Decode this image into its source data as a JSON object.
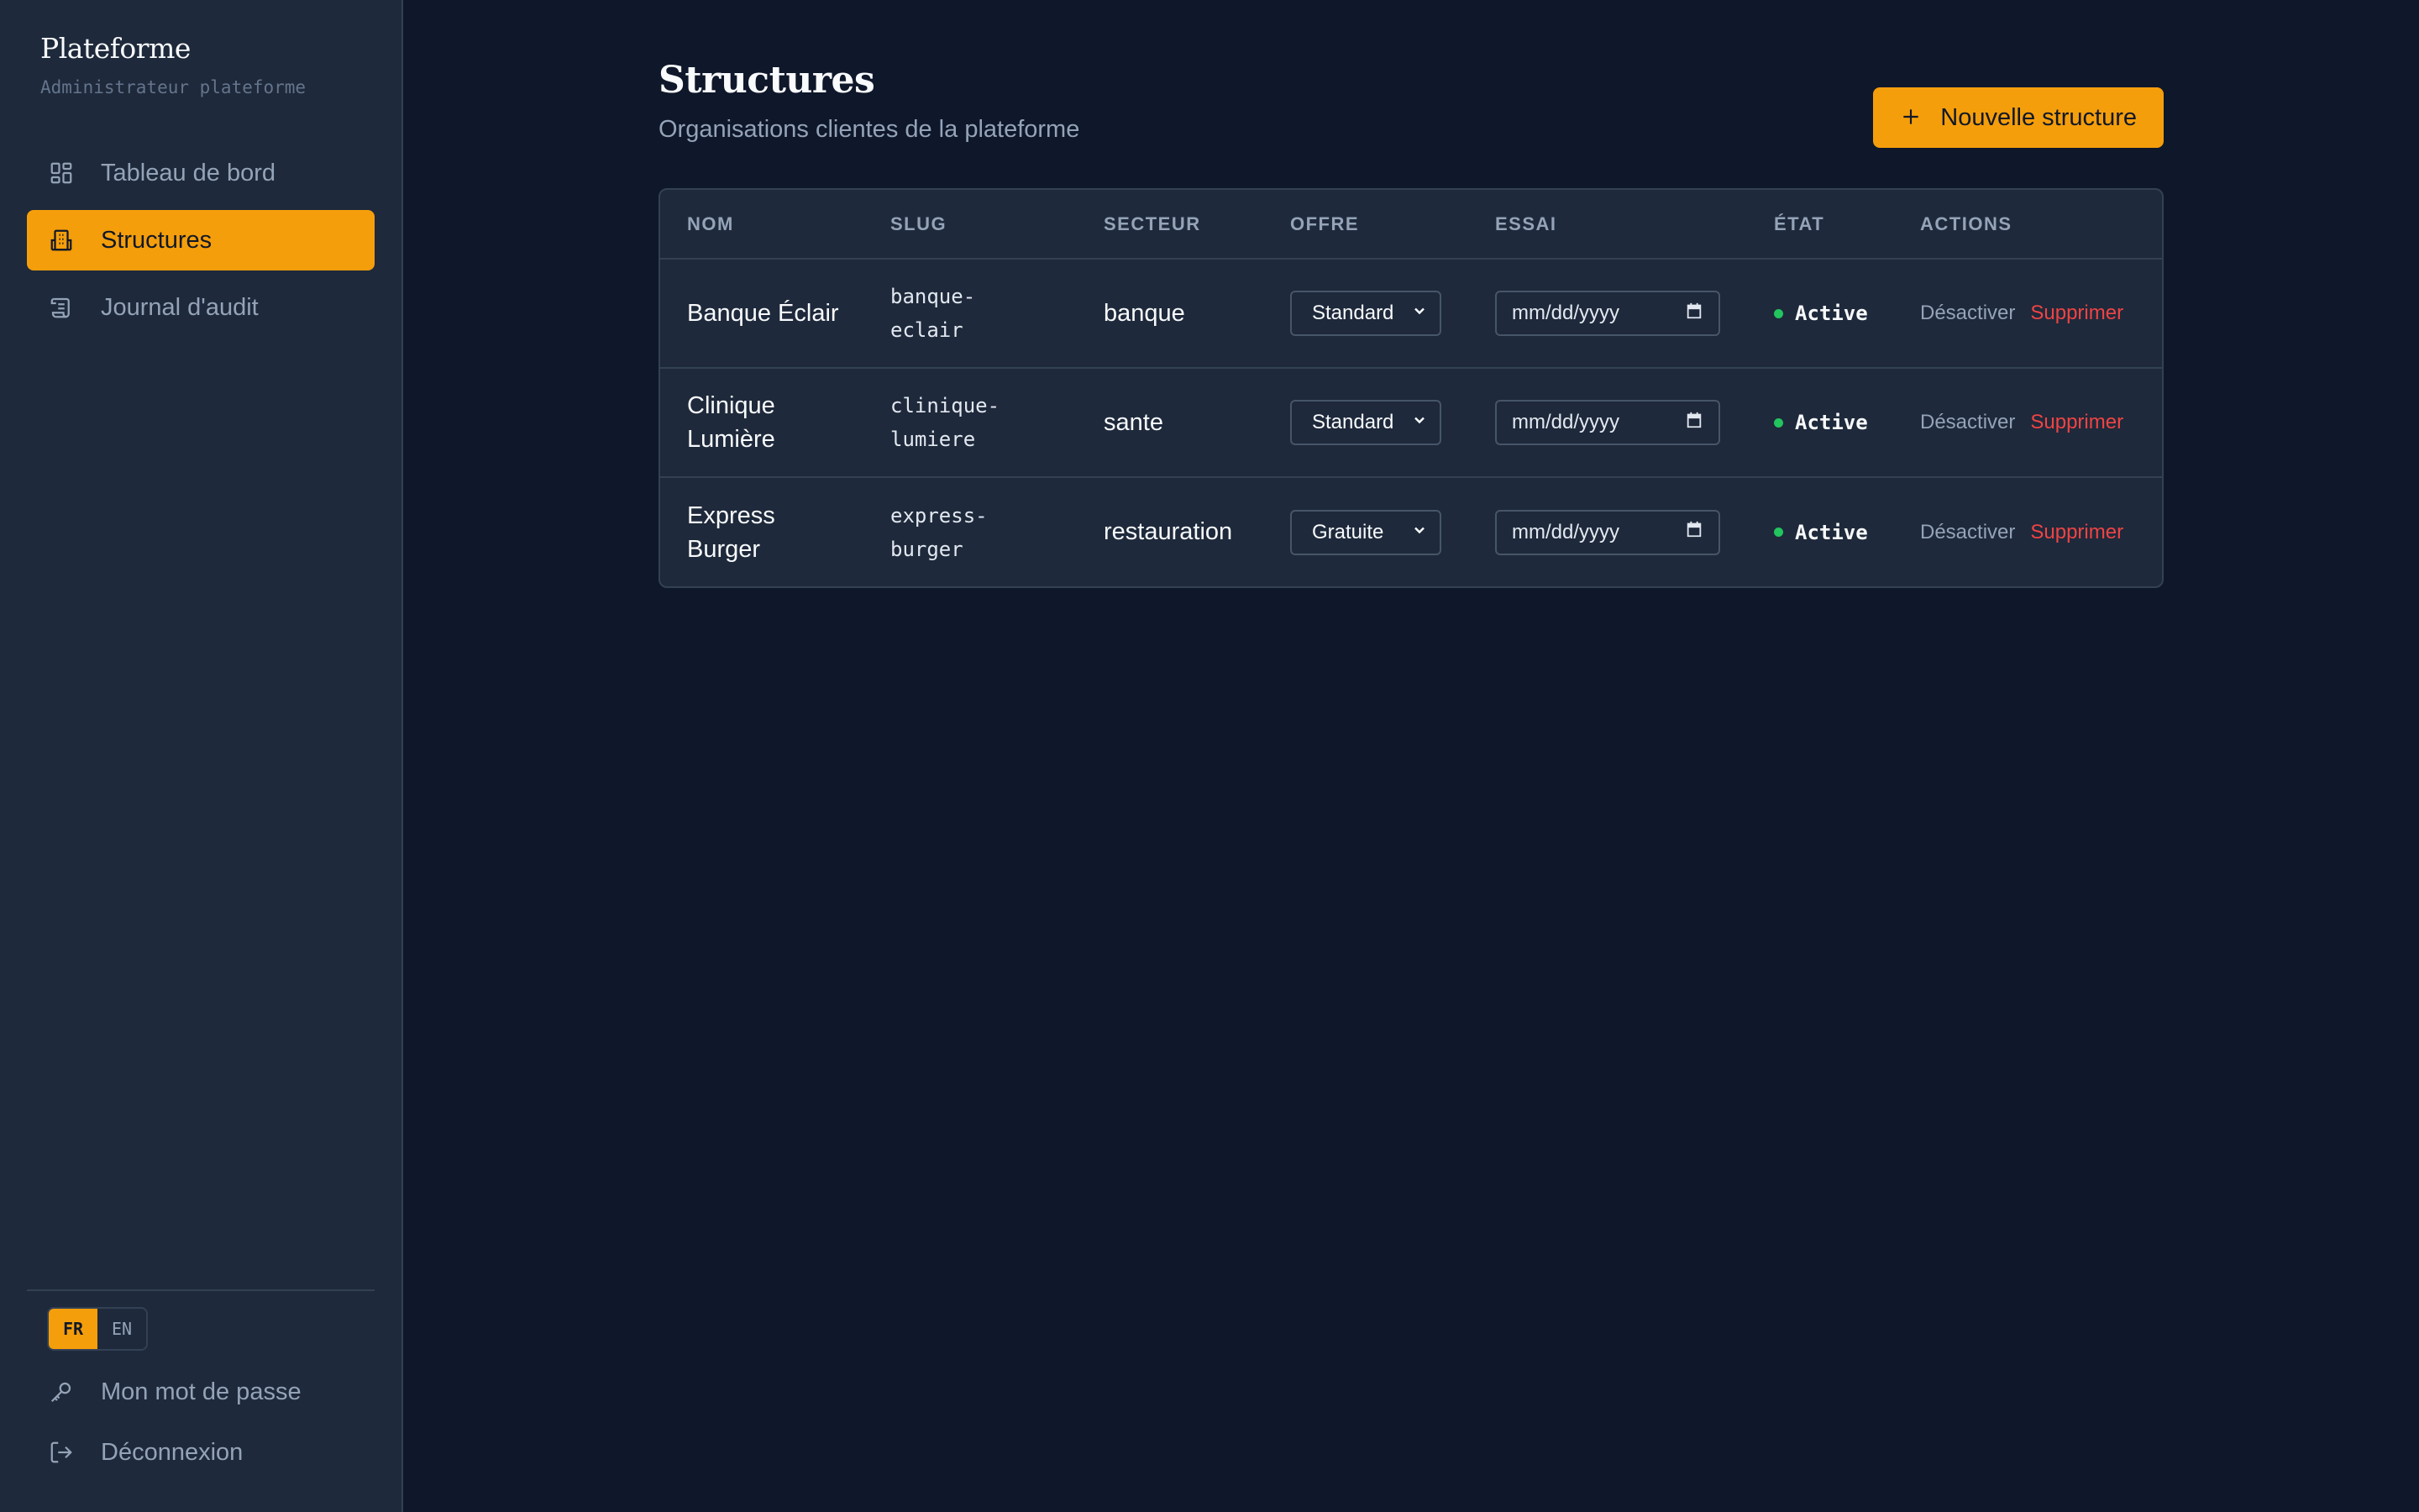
{
  "sidebar": {
    "title": "Plateforme",
    "subtitle": "Administrateur plateforme",
    "items": [
      {
        "label": "Tableau de bord",
        "icon": "dashboard-icon"
      },
      {
        "label": "Structures",
        "icon": "building-icon",
        "active": true
      },
      {
        "label": "Journal d'audit",
        "icon": "scroll-icon"
      }
    ],
    "languages": [
      "FR",
      "EN"
    ],
    "active_language": "FR",
    "password_label": "Mon mot de passe",
    "logout_label": "Déconnexion"
  },
  "page": {
    "title": "Structures",
    "subtitle": "Organisations clientes de la plateforme",
    "new_button": "Nouvelle structure"
  },
  "table": {
    "headers": [
      "NOM",
      "SLUG",
      "SECTEUR",
      "OFFRE",
      "ESSAI",
      "ÉTAT",
      "ACTIONS"
    ],
    "rows": [
      {
        "name": "Banque Éclair",
        "slug": "banque-eclair",
        "sector": "banque",
        "offer": "Standard",
        "trial": "mm/dd/yyyy",
        "state": "Active",
        "deactivate": "Désactiver",
        "delete": "Supprimer"
      },
      {
        "name": "Clinique Lumière",
        "slug": "clinique-lumiere",
        "sector": "sante",
        "offer": "Standard",
        "trial": "mm/dd/yyyy",
        "state": "Active",
        "deactivate": "Désactiver",
        "delete": "Supprimer"
      },
      {
        "name": "Express Burger",
        "slug": "express-burger",
        "sector": "restauration",
        "offer": "Gratuite",
        "trial": "mm/dd/yyyy",
        "state": "Active",
        "deactivate": "Désactiver",
        "delete": "Supprimer"
      }
    ]
  },
  "colors": {
    "accent": "#f59e0b",
    "background": "#0f172a",
    "surface": "#1e293b",
    "danger": "#ef4444",
    "success": "#22c55e"
  }
}
